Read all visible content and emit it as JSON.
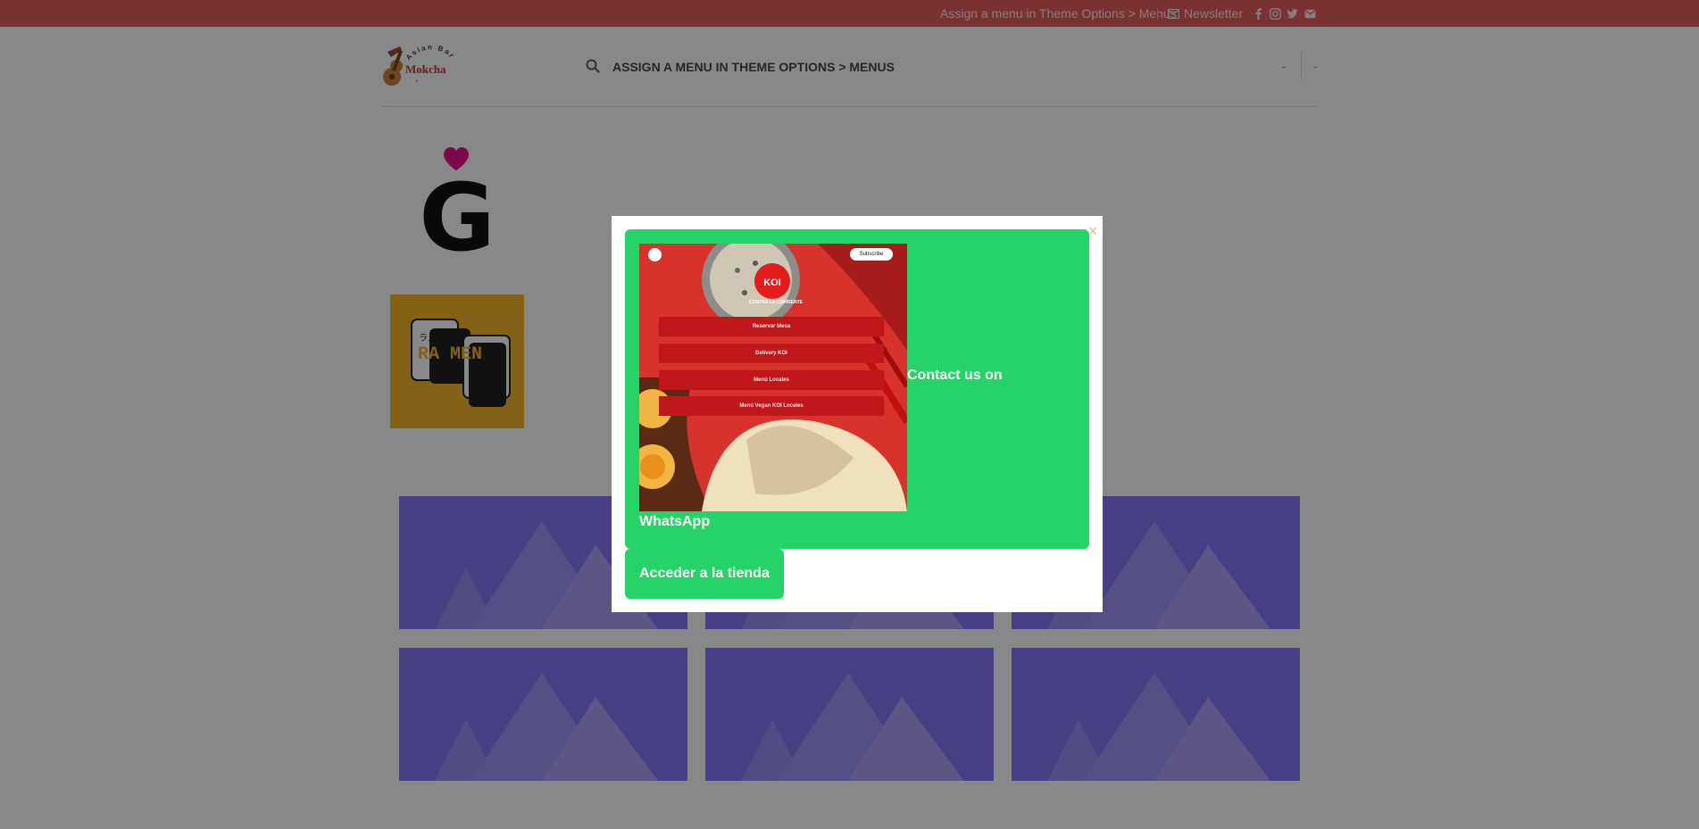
{
  "topbar": {
    "menu_text": "Assign a menu in Theme Options > Menus",
    "newsletter_label": "Newsletter",
    "icons": [
      "envelope-icon",
      "facebook-icon",
      "instagram-icon",
      "twitter-icon",
      "email-icon"
    ],
    "background": "#e0524f"
  },
  "header": {
    "logo_text": "Mokcha",
    "logo_arc_text": "Asian Bar",
    "menu_text": "ASSIGN A MENU IN THEME OPTIONS > MENUS",
    "right_dash_1": "-",
    "right_dash_2": "-"
  },
  "content": {
    "big_letter": "G",
    "heart_color": "#e6007e",
    "ramen_tile_text": "RA MEN",
    "ramen_tile_kana": "ラメン",
    "placeholder_color": "#7d6bf5"
  },
  "modal": {
    "close_symbol": "×",
    "whatsapp_text_part1": "Contact us on",
    "whatsapp_text_part2": "WhatsApp",
    "shop_button_label": "Acceder a la tienda",
    "green": "#25d366",
    "thumbnail": {
      "brand": "KOI",
      "subscribe_label": "Subscribe",
      "tagline": "CONTRA LA CORRIENTE",
      "buttons": [
        "Reservar Mesa",
        "Delivery KOI",
        "Menú Locales",
        "Menú Vegan KOI Locales"
      ]
    }
  }
}
